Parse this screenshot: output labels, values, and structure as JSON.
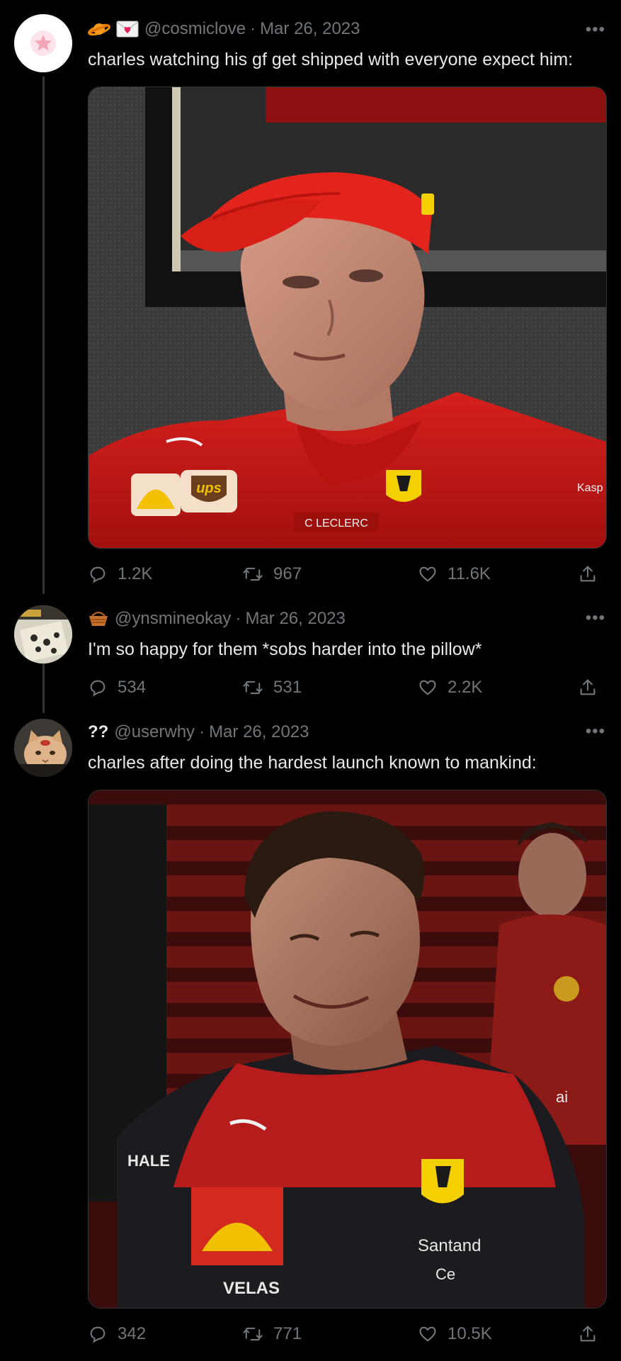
{
  "tweets": [
    {
      "handle": "@cosmiclove",
      "date": "Mar 26, 2023",
      "text": "charles watching his gf get shipped with everyone expect him:",
      "emojis": [
        "ringed-planet-icon",
        "envelope-heart-icon"
      ],
      "stats": {
        "replies": "1.2K",
        "retweets": "967",
        "likes": "11.6K"
      },
      "media": {
        "jersey_lettering": [
          "ups",
          "C LECLERC",
          "Kasp"
        ]
      }
    },
    {
      "handle": "@ynsmineokay",
      "date": "Mar 26, 2023",
      "text": "I'm so happy for them *sobs harder into the pillow*",
      "emojis": [
        "basket-icon"
      ],
      "stats": {
        "replies": "534",
        "retweets": "531",
        "likes": "2.2K"
      }
    },
    {
      "name": "??",
      "handle": "@userwhy",
      "date": "Mar 26, 2023",
      "text": "charles after doing the hardest launch known to mankind:",
      "stats": {
        "replies": "342",
        "retweets": "771",
        "likes": "10.5K"
      },
      "media": {
        "jersey_lettering": [
          "VELAS",
          "Santand",
          "Ce",
          "HALE",
          "ai"
        ]
      }
    }
  ],
  "ui": {
    "separator": "·",
    "more": "•••"
  },
  "colors": {
    "background": "#000000",
    "text": "#e7e9ea",
    "muted": "#71767b",
    "ferrari_red": "#c8161d"
  }
}
